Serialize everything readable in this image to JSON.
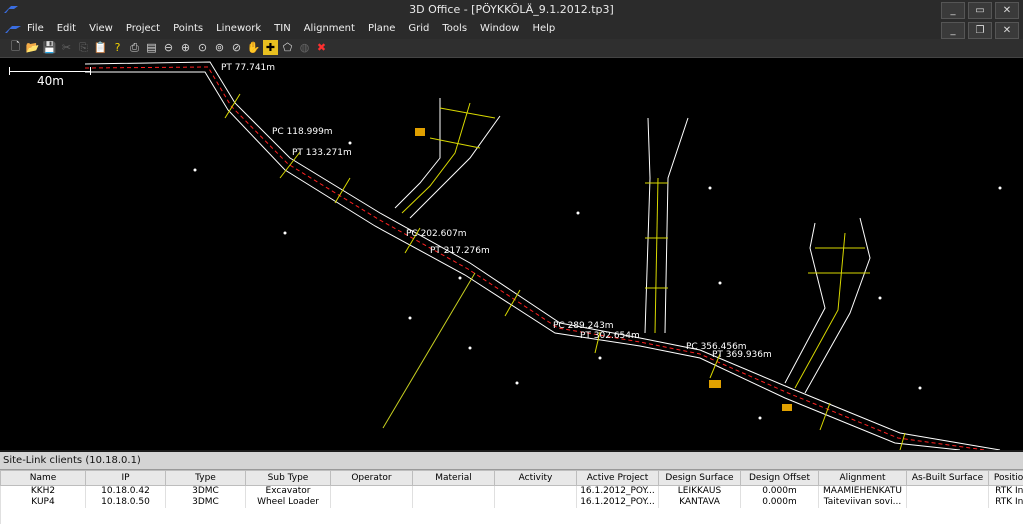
{
  "window": {
    "title": "3D Office - [PÖYKKÖLÄ_9.1.2012.tp3]"
  },
  "menu": {
    "items": [
      "File",
      "Edit",
      "View",
      "Project",
      "Points",
      "Linework",
      "TIN",
      "Alignment",
      "Plane",
      "Grid",
      "Tools",
      "Window",
      "Help"
    ]
  },
  "toolbar": {
    "icons": [
      "new-icon",
      "open-icon",
      "save-icon",
      "cut-icon",
      "copy-icon",
      "paste-icon",
      "help-icon",
      "print-icon",
      "print-preview-icon",
      "zoom-out-icon",
      "zoom-in-icon",
      "zoom-window-icon",
      "zoom-extents-icon",
      "zoom-previous-icon",
      "pan-hand-icon",
      "crosshair-icon",
      "polygon-icon",
      "rotate-icon",
      "snap-icon"
    ]
  },
  "map": {
    "scale_label": "40m",
    "labels": [
      "PT 77.741m",
      "PC 118.999m",
      "PT 133.271m",
      "PC 202.607m",
      "PT 217.276m",
      "PC 289.243m",
      "PT 302.654m",
      "PC 356.456m",
      "PT 369.936m"
    ]
  },
  "sitelink": {
    "title": "Site-Link clients (10.18.0.1)",
    "columns": [
      "Name",
      "IP",
      "Type",
      "Sub Type",
      "Operator",
      "Material",
      "Activity",
      "Active Project",
      "Design Surface",
      "Design Offset",
      "Alignment",
      "As-Built Surface",
      "Position C"
    ],
    "rows": [
      [
        "KKH2",
        "10.18.0.42",
        "3DMC",
        "Excavator",
        "",
        "",
        "",
        "16.1.2012_PÖY...",
        "LEIKKAUS",
        "0.000m",
        "MAAMIEHENKATU",
        "",
        "RTK Initia"
      ],
      [
        "KUP4",
        "10.18.0.50",
        "3DMC",
        "Wheel Loader",
        "",
        "",
        "",
        "16.1.2012_PÖY...",
        "KANTAVA",
        "0.000m",
        "Taiteviivan sovi...",
        "",
        "RTK Initia"
      ]
    ]
  },
  "colors": {
    "road_edge": "#ffffff",
    "centerline": "#ff2020",
    "crosslines": "#d8d800",
    "points": "#ffffff",
    "machine": "#e0a000"
  }
}
